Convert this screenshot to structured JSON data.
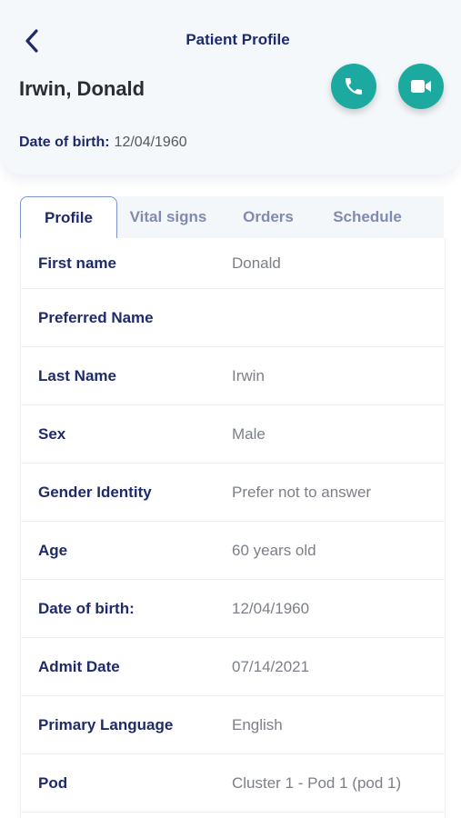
{
  "header": {
    "title": "Patient Profile",
    "patient_name": "Irwin, Donald",
    "dob_label": "Date of birth:",
    "dob_value": "12/04/1960",
    "back_icon": "chevron-left-icon",
    "call_icon": "phone-icon",
    "video_icon": "video-camera-icon",
    "accent_color": "#1ba9a0",
    "brand_color": "#1f2a6b"
  },
  "tabs": [
    {
      "label": "Profile",
      "active": true
    },
    {
      "label": "Vital signs",
      "active": false
    },
    {
      "label": "Orders",
      "active": false
    },
    {
      "label": "Schedule",
      "active": false
    }
  ],
  "profile": [
    {
      "label": "First name",
      "value": "Donald"
    },
    {
      "label": "Preferred Name",
      "value": ""
    },
    {
      "label": "Last Name",
      "value": "Irwin"
    },
    {
      "label": "Sex",
      "value": "Male"
    },
    {
      "label": "Gender Identity",
      "value": "Prefer not to answer"
    },
    {
      "label": "Age",
      "value": "60 years old"
    },
    {
      "label": "Date of birth:",
      "value": "12/04/1960"
    },
    {
      "label": "Admit Date",
      "value": "07/14/2021"
    },
    {
      "label": "Primary Language",
      "value": "English"
    },
    {
      "label": "Pod",
      "value": "Cluster 1 - Pod 1 (pod 1)"
    }
  ]
}
